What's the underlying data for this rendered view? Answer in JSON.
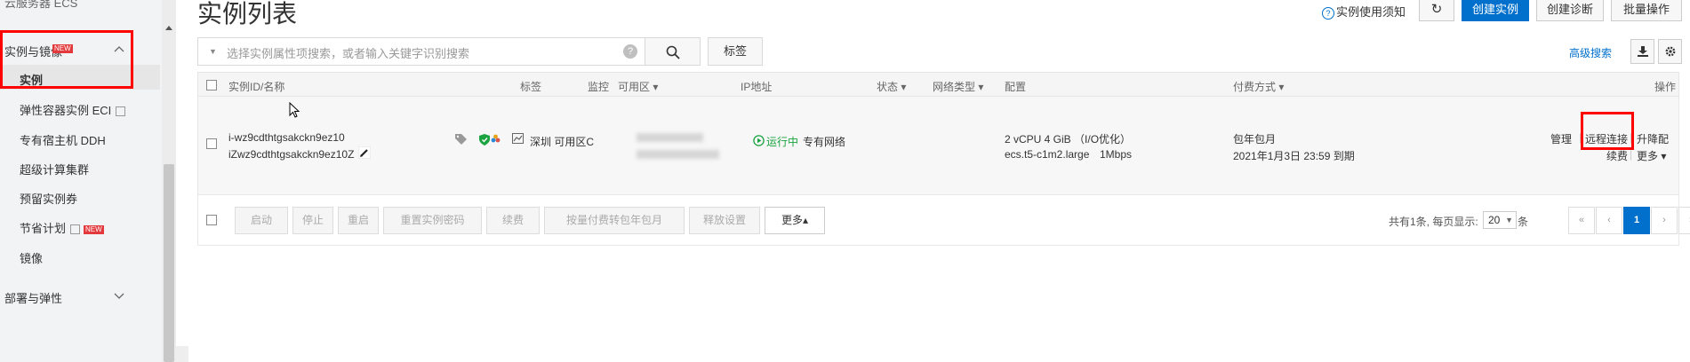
{
  "sidebar": {
    "top_label": "云服务器 ECS",
    "section_instances": "实例与镜像",
    "section_instances_badge": "NEW",
    "items": [
      {
        "label": "实例"
      },
      {
        "label": "弹性容器实例 ECI"
      },
      {
        "label": "专有宿主机 DDH"
      },
      {
        "label": "超级计算集群"
      },
      {
        "label": "预留实例券"
      },
      {
        "label": "节省计划",
        "badge": "NEW"
      },
      {
        "label": "镜像"
      }
    ],
    "section_deploy": "部署与弹性"
  },
  "header": {
    "title": "实例列表",
    "help_link": "实例使用须知",
    "buttons": {
      "refresh": "↻",
      "create_instance": "创建实例",
      "create_diagnosis": "创建诊断",
      "batch_ops": "批量操作"
    }
  },
  "search": {
    "placeholder": "选择实例属性项搜索，或者输入关键字识别搜索",
    "tag_button": "标签",
    "advanced": "高级搜索"
  },
  "table": {
    "columns": [
      "实例ID/名称",
      "标签",
      "监控",
      "可用区",
      "IP地址",
      "状态",
      "网络类型",
      "配置",
      "付费方式",
      "操作"
    ],
    "rows": [
      {
        "instance_id": "i-wz9cdthtgsakckn9ez10",
        "instance_name": "iZwz9cdthtgsakckn9ez10Z",
        "zone": "深圳 可用区C",
        "status": "运行中",
        "network": "专有网络",
        "config_line1": "2 vCPU 4 GiB （I/O优化）",
        "config_type": "ecs.t5-c1m2.large",
        "config_bandwidth": "1Mbps",
        "billing": "包年包月",
        "expire": "2021年1月3日 23:59 到期",
        "actions": {
          "manage": "管理",
          "remote": "远程连接",
          "upgrade": "升降配",
          "renew": "续费",
          "more": "更多"
        }
      }
    ]
  },
  "footer": {
    "buttons": [
      "启动",
      "停止",
      "重启",
      "重置实例密码",
      "续费",
      "按量付费转包年包月",
      "释放设置"
    ],
    "more": "更多▴",
    "summary": "共有1条, 每页显示:",
    "page_size": "20",
    "page_unit": "条",
    "pager": [
      "«",
      "‹",
      "1",
      "›",
      "»"
    ]
  }
}
